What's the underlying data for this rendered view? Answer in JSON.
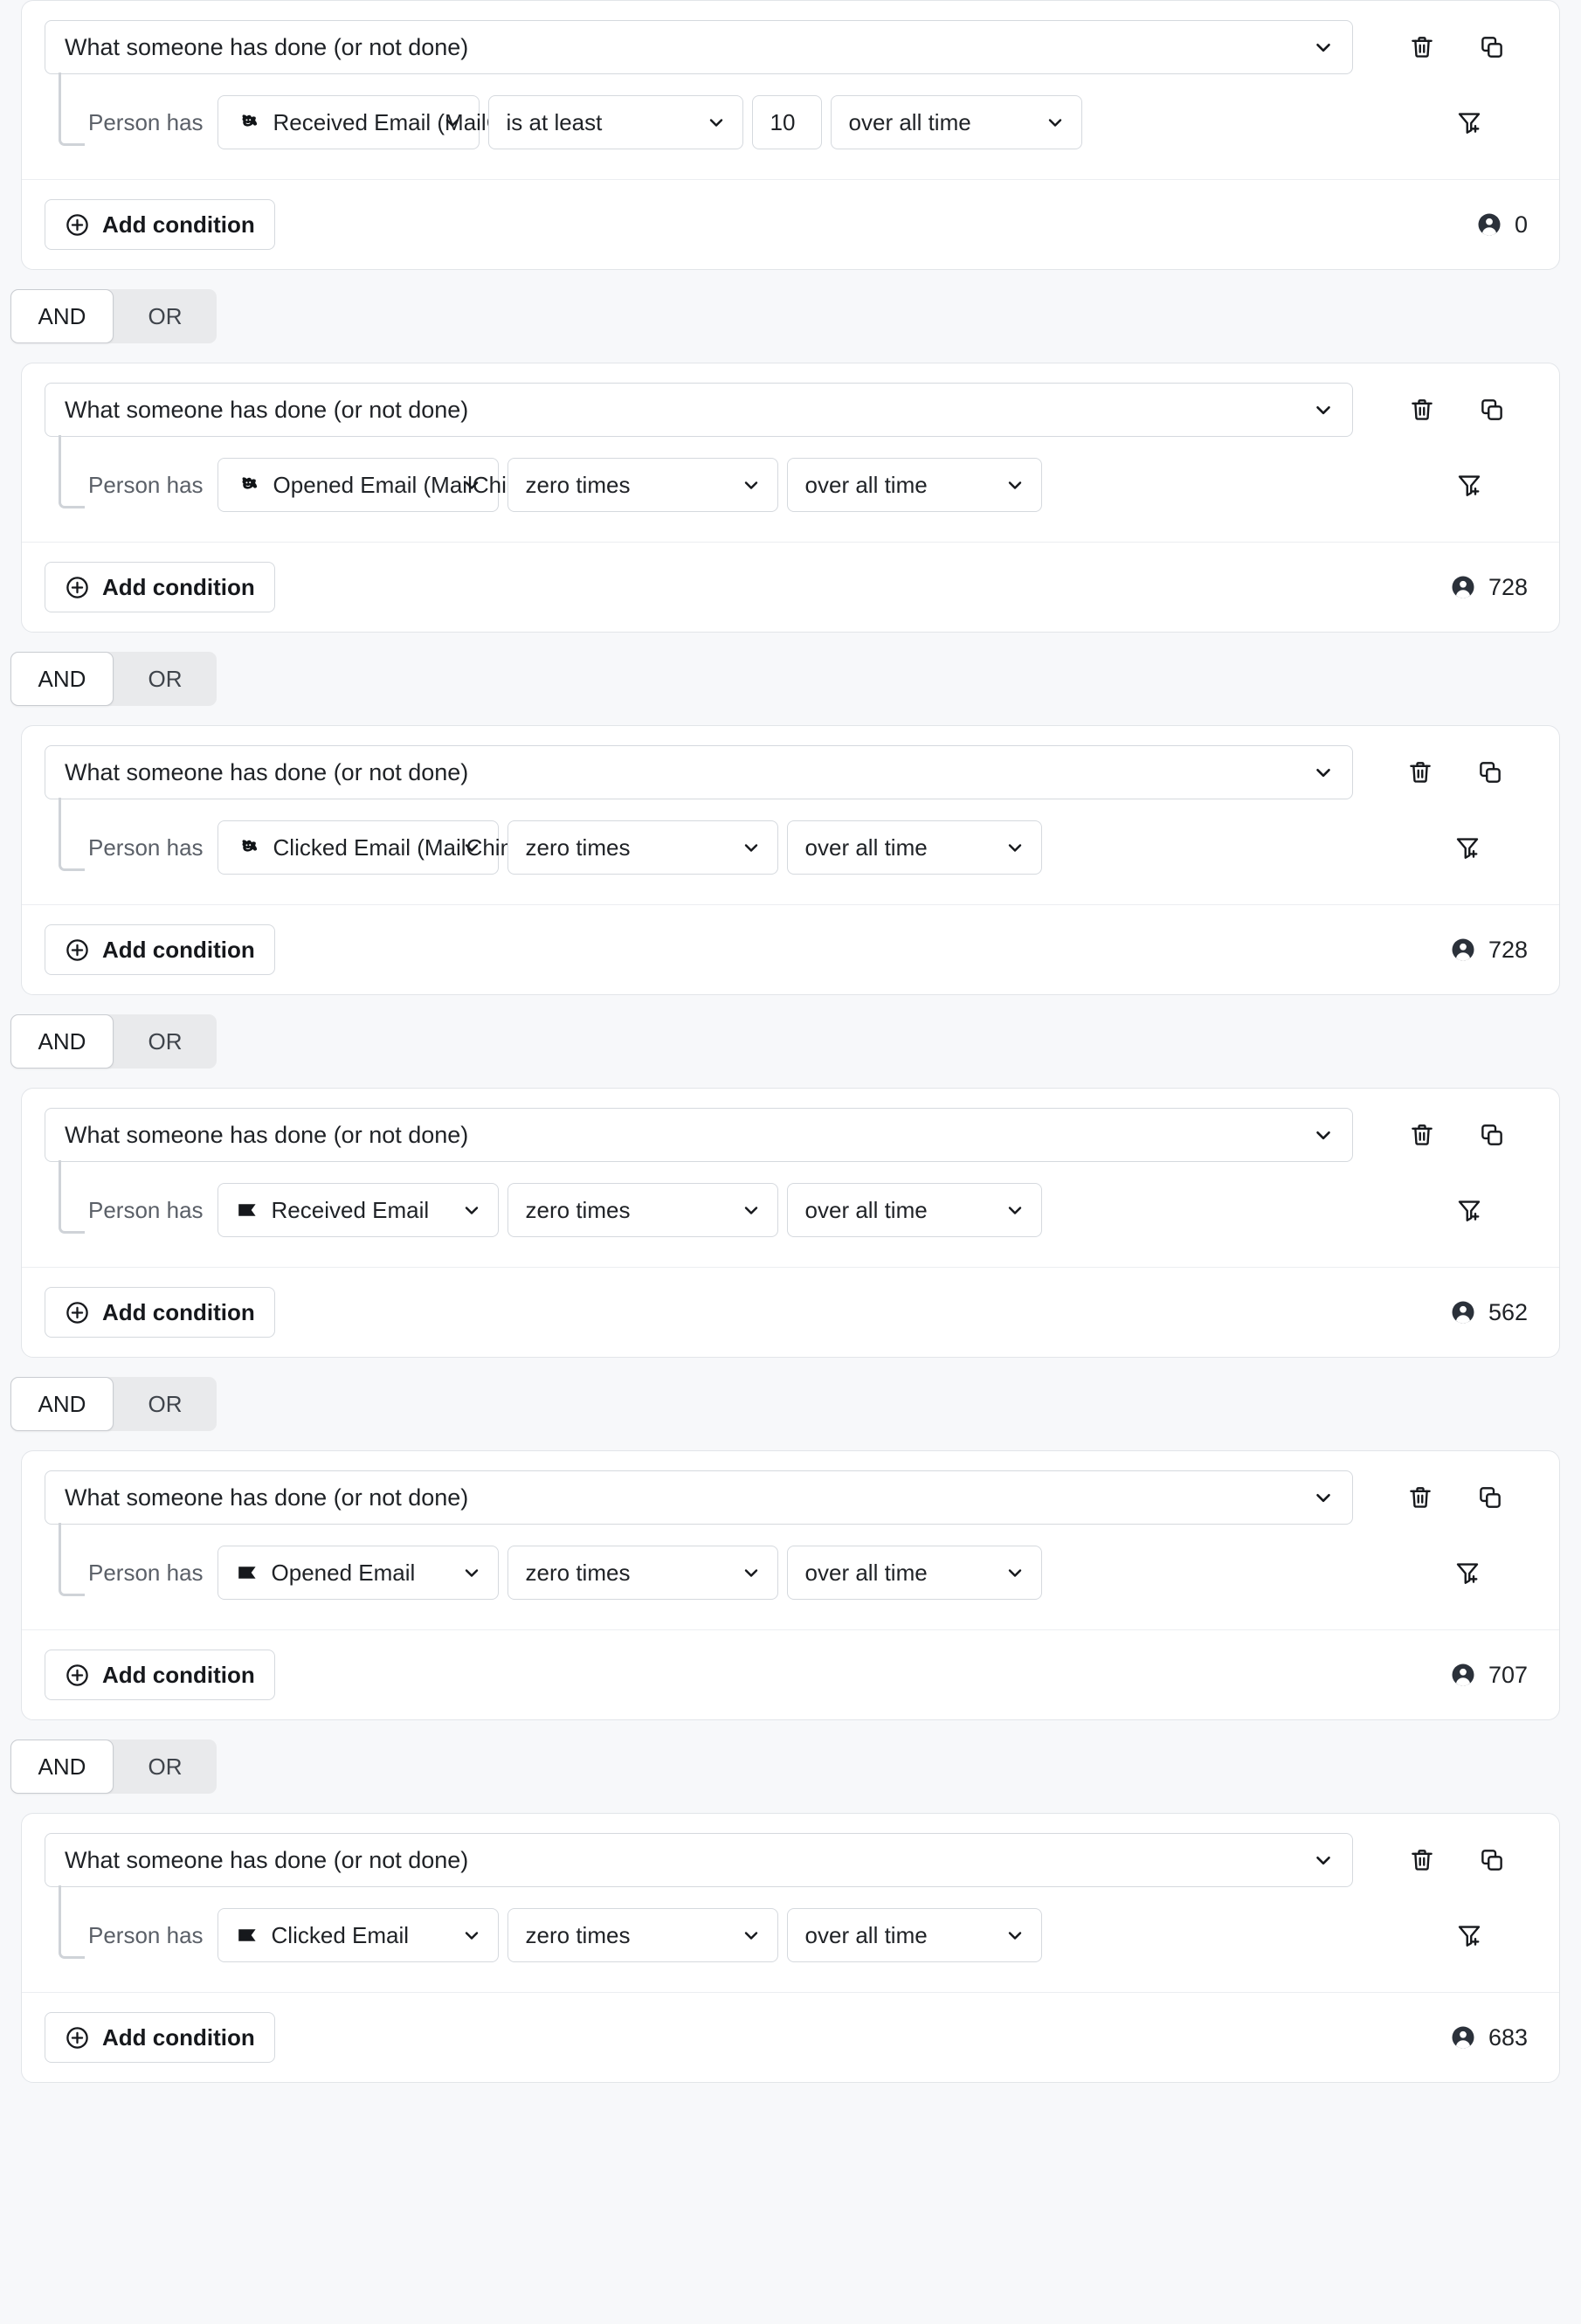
{
  "colors": {
    "page_bg": "#f7f8fa",
    "card_bg": "#ffffff",
    "border": "#d5d9de",
    "muted_text": "#5b6068",
    "accent_dark": "#2b313a"
  },
  "labels": {
    "person_has": "Person has",
    "add_condition": "Add condition",
    "top_select_value": "What someone has done (or not done)"
  },
  "joiners": [
    {
      "and": "AND",
      "or": "OR",
      "selected": "AND"
    },
    {
      "and": "AND",
      "or": "OR",
      "selected": "AND"
    },
    {
      "and": "AND",
      "or": "OR",
      "selected": "AND"
    },
    {
      "and": "AND",
      "or": "OR",
      "selected": "AND"
    },
    {
      "and": "AND",
      "or": "OR",
      "selected": "AND"
    }
  ],
  "blocks": [
    {
      "top_select": "What someone has done (or not done)",
      "person_has": "Person has",
      "event_icon": "mailchimp-icon",
      "event": "Received Email (MailC...",
      "operator": "is at least",
      "count_value": "10",
      "has_count_field": true,
      "timeframe": "over all time",
      "add_condition": "Add condition",
      "people_count": "0"
    },
    {
      "top_select": "What someone has done (or not done)",
      "person_has": "Person has",
      "event_icon": "mailchimp-icon",
      "event": "Opened Email (MailChimp)",
      "operator": "zero times",
      "count_value": "",
      "has_count_field": false,
      "timeframe": "over all time",
      "add_condition": "Add condition",
      "people_count": "728"
    },
    {
      "top_select": "What someone has done (or not done)",
      "person_has": "Person has",
      "event_icon": "mailchimp-icon",
      "event": "Clicked Email (MailChimp)",
      "operator": "zero times",
      "count_value": "",
      "has_count_field": false,
      "timeframe": "over all time",
      "add_condition": "Add condition",
      "people_count": "728"
    },
    {
      "top_select": "What someone has done (or not done)",
      "person_has": "Person has",
      "event_icon": "klaviyo-flag-icon",
      "event": "Received Email",
      "operator": "zero times",
      "count_value": "",
      "has_count_field": false,
      "timeframe": "over all time",
      "add_condition": "Add condition",
      "people_count": "562"
    },
    {
      "top_select": "What someone has done (or not done)",
      "person_has": "Person has",
      "event_icon": "klaviyo-flag-icon",
      "event": "Opened Email",
      "operator": "zero times",
      "count_value": "",
      "has_count_field": false,
      "timeframe": "over all time",
      "add_condition": "Add condition",
      "people_count": "707"
    },
    {
      "top_select": "What someone has done (or not done)",
      "person_has": "Person has",
      "event_icon": "klaviyo-flag-icon",
      "event": "Clicked Email",
      "operator": "zero times",
      "count_value": "",
      "has_count_field": false,
      "timeframe": "over all time",
      "add_condition": "Add condition",
      "people_count": "683"
    }
  ],
  "icons": {
    "delete": "trash-icon",
    "duplicate": "copy-icon",
    "add_filter": "filter-plus-icon",
    "people": "person-icon",
    "plus": "plus-circle-icon",
    "caret": "chevron-down-icon"
  }
}
